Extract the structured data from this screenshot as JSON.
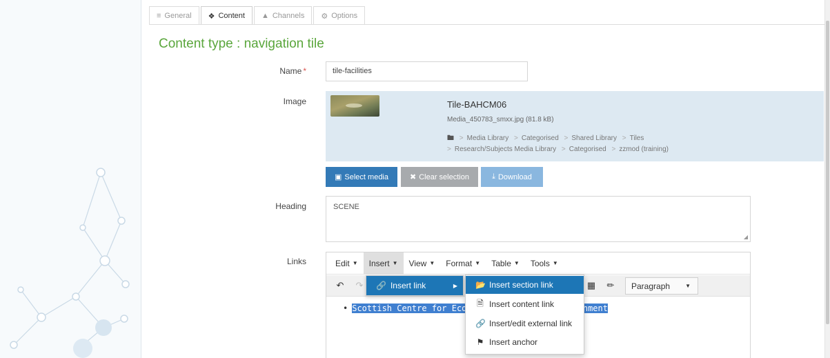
{
  "tabs": [
    {
      "label": "General",
      "icon": "sliders-icon"
    },
    {
      "label": "Content",
      "icon": "cubes-icon"
    },
    {
      "label": "Channels",
      "icon": "sitemap-icon"
    },
    {
      "label": "Options",
      "icon": "cogs-icon"
    }
  ],
  "active_tab": "Content",
  "page_title": "Content type : navigation tile",
  "form": {
    "name_label": "Name",
    "name_required_mark": "*",
    "name_value": "tile-facilities",
    "image_label": "Image",
    "heading_label": "Heading",
    "heading_value": "SCENE",
    "links_label": "Links"
  },
  "image": {
    "title": "Tile-BAHCM06",
    "file": "Media_450783_smxx.jpg (81.8 kB)",
    "path_line1": [
      "Media Library",
      "Categorised",
      "Shared Library",
      "Tiles"
    ],
    "path_line2": [
      "Research/Subjects Media Library",
      "Categorised",
      "zzmod (training)"
    ],
    "buttons": {
      "select": "Select media",
      "clear": "Clear selection",
      "download": "Download"
    }
  },
  "editor": {
    "menus": [
      "Edit",
      "Insert",
      "View",
      "Format",
      "Table",
      "Tools"
    ],
    "open_menu": "Insert",
    "paragraph_select": "Paragraph",
    "content_prefix": "Scottish Centre for Ecolo",
    "content_suffix": "nment",
    "insert_submenu": {
      "label": "Insert link"
    },
    "link_flyout": [
      {
        "label": "Insert section link",
        "icon": "folder-open-icon",
        "highlighted": true
      },
      {
        "label": "Insert content link",
        "icon": "file-icon",
        "highlighted": false
      },
      {
        "label": "Insert/edit external link",
        "icon": "link-icon",
        "highlighted": false
      },
      {
        "label": "Insert anchor",
        "icon": "bookmark-icon",
        "highlighted": false
      }
    ]
  },
  "colors": {
    "title_green": "#5aa63c",
    "primary_blue": "#337ab7",
    "menu_highlight": "#1d76b6",
    "image_panel_bg": "#dde9f2"
  }
}
